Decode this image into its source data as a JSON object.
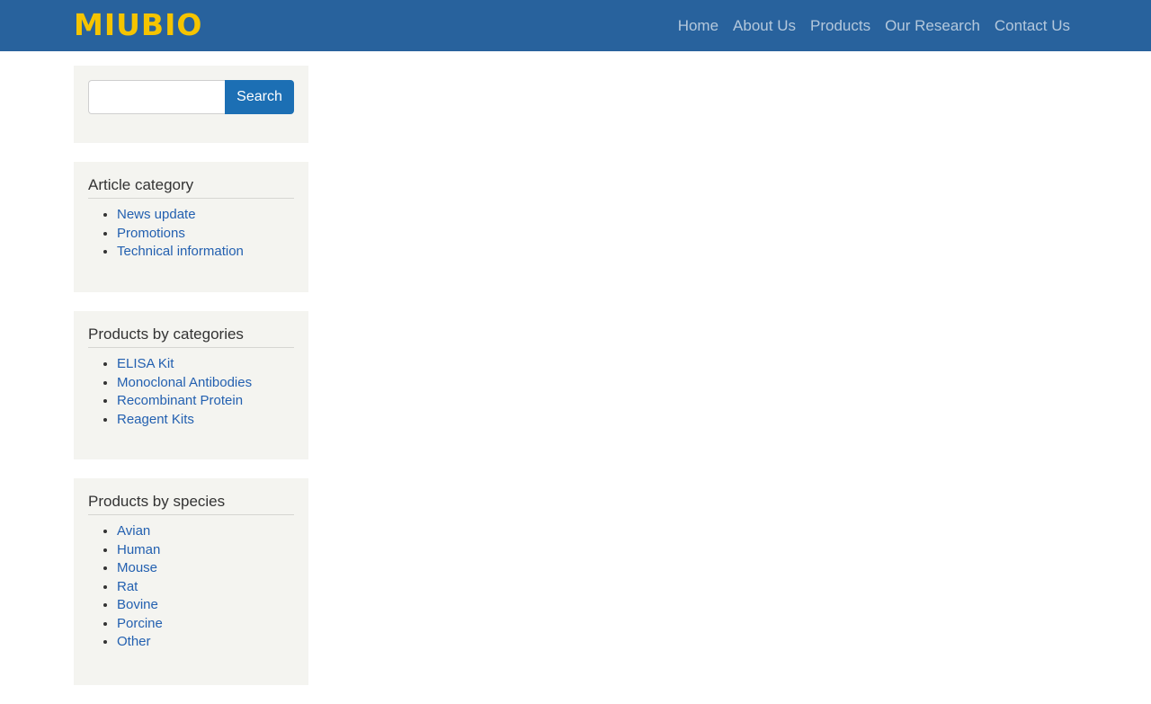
{
  "header": {
    "logo": "MIUBIO",
    "nav": [
      "Home",
      "About Us",
      "Products",
      "Our Research",
      "Contact Us"
    ]
  },
  "search": {
    "placeholder": "",
    "value": "",
    "button_label": "Search"
  },
  "article_category": {
    "title": "Article category",
    "items": [
      "News update",
      "Promotions",
      "Technical information"
    ]
  },
  "products_by_categories": {
    "title": "Products by categories",
    "items": [
      "ELISA Kit",
      "Monoclonal Antibodies",
      "Recombinant Protein",
      "Reagent Kits"
    ]
  },
  "products_by_species": {
    "title": "Products by species",
    "items": [
      "Avian",
      "Human",
      "Mouse",
      "Rat",
      "Bovine",
      "Porcine",
      "Other"
    ]
  },
  "colors": {
    "navbar": "#28629d",
    "logo": "#f5c400",
    "nav_link": "#b4c8dc",
    "button": "#1c6fb4",
    "link": "#2360b0",
    "panel": "#f4f4f0"
  }
}
